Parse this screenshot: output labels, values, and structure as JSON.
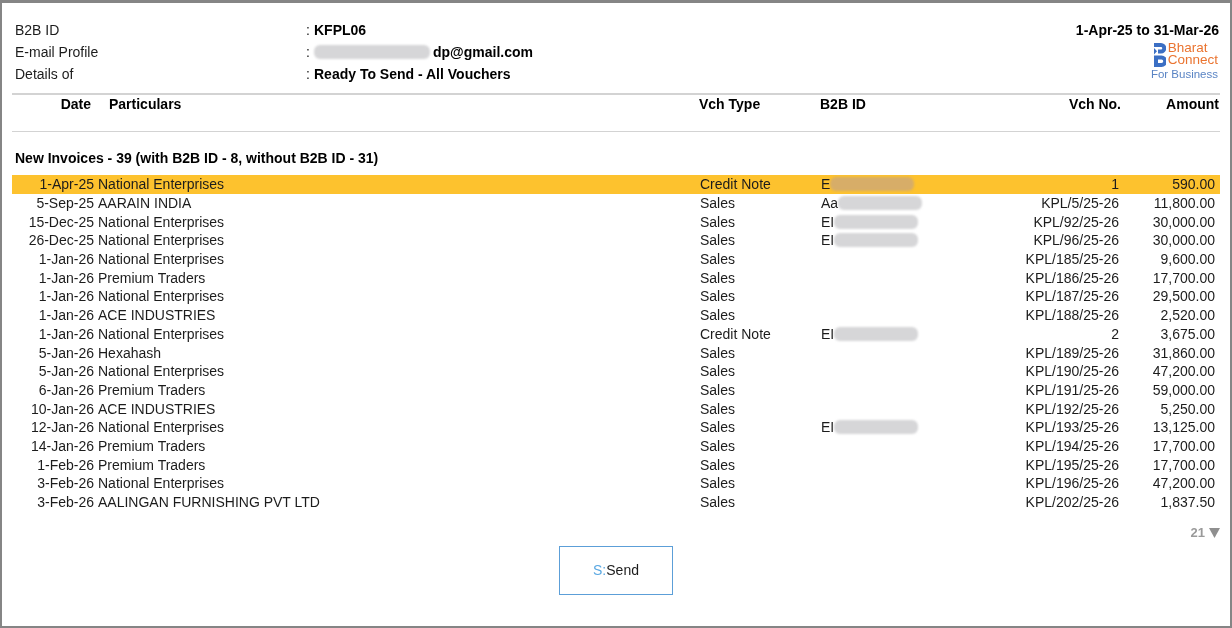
{
  "header": {
    "fields": [
      {
        "label": "B2B ID",
        "colon": ":",
        "value": "KFPL06",
        "redacted": false
      },
      {
        "label": "E-mail Profile",
        "colon": ":",
        "value": "dp@gmail.com",
        "redacted": true
      },
      {
        "label": "Details of",
        "colon": ":",
        "value": "Ready To Send - All Vouchers",
        "redacted": false
      }
    ],
    "period": "1-Apr-25 to 31-Mar-26",
    "logo": {
      "line_1": "Bharat",
      "line_2": "Connect",
      "line_3": "For Business"
    }
  },
  "table": {
    "columns": [
      "Date",
      "Particulars",
      "Vch Type",
      "B2B ID",
      "Vch No.",
      "Amount"
    ],
    "group": "New Invoices - 39 (with B2B ID - 8, without B2B ID - 31)",
    "rows": [
      {
        "date": "1-Apr-25",
        "particulars": "National Enterprises",
        "vch_type": "Credit Note",
        "b2b_id": "E",
        "redacted": true,
        "vch_no": "1",
        "amount": "590.00",
        "selected": true
      },
      {
        "date": "5-Sep-25",
        "particulars": "AARAIN INDIA",
        "vch_type": "Sales",
        "b2b_id": "Aa",
        "redacted": true,
        "vch_no": "KPL/5/25-26",
        "amount": "11,800.00",
        "selected": false
      },
      {
        "date": "15-Dec-25",
        "particulars": "National Enterprises",
        "vch_type": "Sales",
        "b2b_id": "EI",
        "redacted": true,
        "vch_no": "KPL/92/25-26",
        "amount": "30,000.00",
        "selected": false
      },
      {
        "date": "26-Dec-25",
        "particulars": "National Enterprises",
        "vch_type": "Sales",
        "b2b_id": "EI",
        "redacted": true,
        "vch_no": "KPL/96/25-26",
        "amount": "30,000.00",
        "selected": false
      },
      {
        "date": "1-Jan-26",
        "particulars": "National Enterprises",
        "vch_type": "Sales",
        "redacted": false,
        "vch_no": "KPL/185/25-26",
        "amount": "9,600.00",
        "selected": false
      },
      {
        "date": "1-Jan-26",
        "particulars": "Premium Traders",
        "vch_type": "Sales",
        "redacted": false,
        "vch_no": "KPL/186/25-26",
        "amount": "17,700.00",
        "selected": false
      },
      {
        "date": "1-Jan-26",
        "particulars": "National Enterprises",
        "vch_type": "Sales",
        "redacted": false,
        "vch_no": "KPL/187/25-26",
        "amount": "29,500.00",
        "selected": false
      },
      {
        "date": "1-Jan-26",
        "particulars": "ACE INDUSTRIES",
        "vch_type": "Sales",
        "redacted": false,
        "vch_no": "KPL/188/25-26",
        "amount": "2,520.00",
        "selected": false
      },
      {
        "date": "1-Jan-26",
        "particulars": "National Enterprises",
        "vch_type": "Credit Note",
        "b2b_id": "EI",
        "redacted": true,
        "vch_no": "2",
        "amount": "3,675.00",
        "selected": false
      },
      {
        "date": "5-Jan-26",
        "particulars": "Hexahash",
        "vch_type": "Sales",
        "redacted": false,
        "vch_no": "KPL/189/25-26",
        "amount": "31,860.00",
        "selected": false
      },
      {
        "date": "5-Jan-26",
        "particulars": "National Enterprises",
        "vch_type": "Sales",
        "redacted": false,
        "vch_no": "KPL/190/25-26",
        "amount": "47,200.00",
        "selected": false
      },
      {
        "date": "6-Jan-26",
        "particulars": "Premium Traders",
        "vch_type": "Sales",
        "redacted": false,
        "vch_no": "KPL/191/25-26",
        "amount": "59,000.00",
        "selected": false
      },
      {
        "date": "10-Jan-26",
        "particulars": "ACE INDUSTRIES",
        "vch_type": "Sales",
        "redacted": false,
        "vch_no": "KPL/192/25-26",
        "amount": "5,250.00",
        "selected": false
      },
      {
        "date": "12-Jan-26",
        "particulars": "National Enterprises",
        "vch_type": "Sales",
        "b2b_id": "EI",
        "redacted": true,
        "vch_no": "KPL/193/25-26",
        "amount": "13,125.00",
        "selected": false
      },
      {
        "date": "14-Jan-26",
        "particulars": "Premium Traders",
        "vch_type": "Sales",
        "redacted": false,
        "vch_no": "KPL/194/25-26",
        "amount": "17,700.00",
        "selected": false
      },
      {
        "date": "1-Feb-26",
        "particulars": "Premium Traders",
        "vch_type": "Sales",
        "redacted": false,
        "vch_no": "KPL/195/25-26",
        "amount": "17,700.00",
        "selected": false
      },
      {
        "date": "3-Feb-26",
        "particulars": "National Enterprises",
        "vch_type": "Sales",
        "redacted": false,
        "vch_no": "KPL/196/25-26",
        "amount": "47,200.00",
        "selected": false
      },
      {
        "date": "3-Feb-26",
        "particulars": "AALINGAN FURNISHING PVT LTD",
        "vch_type": "Sales",
        "redacted": false,
        "vch_no": "KPL/202/25-26",
        "amount": "1,837.50",
        "selected": false
      }
    ]
  },
  "page_indicator": "21",
  "button": {
    "hotkey": "S:",
    "label": "Send"
  }
}
